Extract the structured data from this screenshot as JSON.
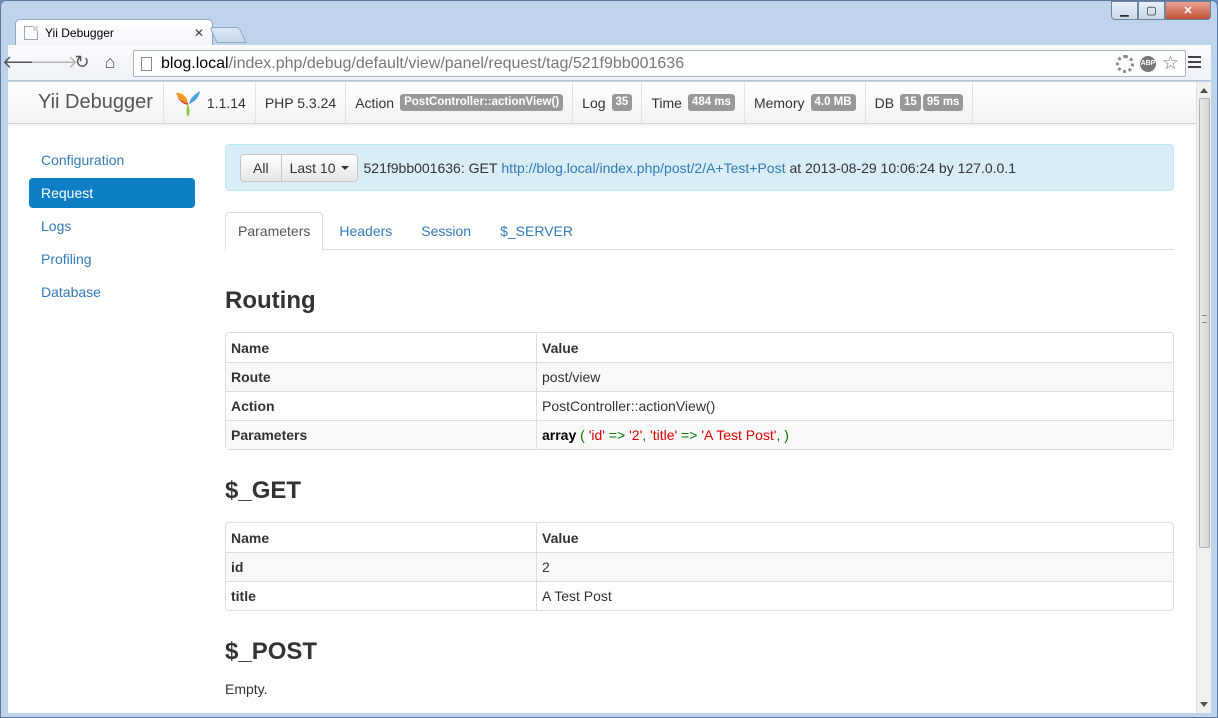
{
  "browser": {
    "tab_title": "Yii Debugger",
    "url_host": "blog.local",
    "url_path": "/index.php/debug/default/view/panel/request/tag/521f9bb001636"
  },
  "toolbar": {
    "brand": "Yii Debugger",
    "version": "1.1.14",
    "php": "PHP 5.3.24",
    "action_label": "Action",
    "action_value": "PostController::actionView()",
    "log_label": "Log",
    "log_value": "35",
    "time_label": "Time",
    "time_value": "484 ms",
    "memory_label": "Memory",
    "memory_value": "4.0 MB",
    "db_label": "DB",
    "db_count": "15",
    "db_time": "95 ms"
  },
  "sidebar": {
    "items": [
      {
        "label": "Configuration"
      },
      {
        "label": "Request"
      },
      {
        "label": "Logs"
      },
      {
        "label": "Profiling"
      },
      {
        "label": "Database"
      }
    ],
    "active": "Request"
  },
  "summary": {
    "all_button": "All",
    "last_button": "Last 10",
    "tag_text": "521f9bb001636: GET",
    "link": "http://blog.local/index.php/post/2/A+Test+Post",
    "suffix": "at 2013-08-29 10:06:24 by 127.0.0.1"
  },
  "tabs": [
    {
      "label": "Parameters"
    },
    {
      "label": "Headers"
    },
    {
      "label": "Session"
    },
    {
      "label": "$_SERVER"
    }
  ],
  "routing": {
    "heading": "Routing",
    "col_name": "Name",
    "col_value": "Value",
    "rows": [
      {
        "name": "Route",
        "value": "post/view"
      },
      {
        "name": "Action",
        "value": "PostController::actionView()"
      },
      {
        "name": "Parameters",
        "value_kw": "array",
        "value_open": " ( ",
        "key1": "'id'",
        "arrow1": " => ",
        "val1": "'2'",
        "sep": ", ",
        "key2": "'title'",
        "arrow2": " => ",
        "val2": "'A Test Post'",
        "value_close": ", )"
      }
    ]
  },
  "get": {
    "heading": "$_GET",
    "col_name": "Name",
    "col_value": "Value",
    "rows": [
      {
        "name": "id",
        "value": "2"
      },
      {
        "name": "title",
        "value": "A Test Post"
      }
    ]
  },
  "post": {
    "heading": "$_POST",
    "empty": "Empty."
  }
}
